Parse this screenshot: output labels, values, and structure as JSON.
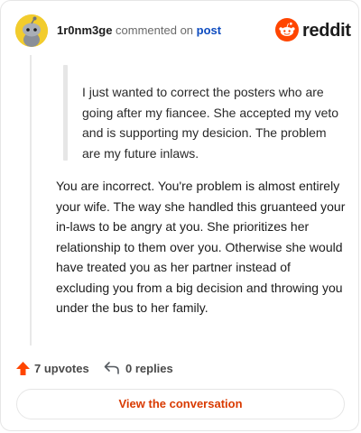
{
  "header": {
    "username": "1r0nm3ge",
    "action_text": "commented on",
    "post_link": "post",
    "brand_name": "reddit"
  },
  "quote": {
    "text": "I just wanted to correct the posters who are going after my fiancee. She accepted my veto and is supporting my desicion. The problem are my future inlaws."
  },
  "comment": {
    "text": "You are incorrect. You're problem is almost entirely your wife. The way she handled this gruanteed your in-laws to be angry at you. She prioritizes her relationship to them over you. Otherwise she would have treated you as her partner instead of excluding you from a big decision and throwing you under the bus to her family."
  },
  "actions": {
    "upvotes_label": "7 upvotes",
    "replies_label": "0 replies"
  },
  "cta": {
    "label": "View the conversation"
  },
  "colors": {
    "brand": "#ff4500",
    "link": "#0e4cc0",
    "cta_text": "#d93a00",
    "avatar_bg": "#f2cc2d"
  }
}
